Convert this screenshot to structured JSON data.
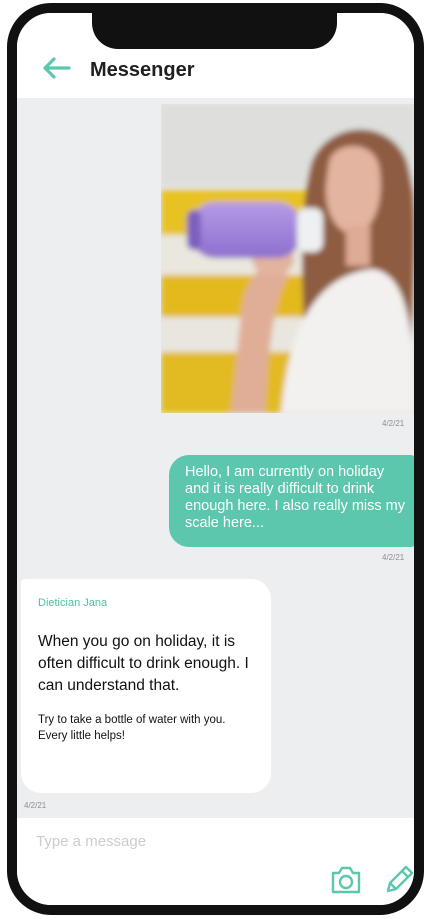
{
  "header": {
    "title": "Messenger",
    "back_icon": "arrow-left-icon"
  },
  "colors": {
    "accent": "#5cc7ad",
    "chat_background": "#eceef0",
    "frame": "#111111"
  },
  "messages": [
    {
      "type": "image",
      "direction": "outgoing",
      "timestamp": "4/2/21"
    },
    {
      "type": "text",
      "direction": "outgoing",
      "text": "Hello, I am currently on holiday and it is really difficult to drink enough here. I also really miss my scale here...",
      "timestamp": "4/2/21"
    },
    {
      "type": "text",
      "direction": "incoming",
      "sender": "Dietician Jana",
      "text": "When you go on holiday, it is often difficult to drink enough. I can understand that.",
      "subtext": "Try to take a bottle of water with you. Every little helps!",
      "timestamp": "4/2/21"
    }
  ],
  "composer": {
    "placeholder": "Type a message",
    "value": "",
    "camera_icon": "camera-icon",
    "pencil_icon": "pencil-icon"
  }
}
